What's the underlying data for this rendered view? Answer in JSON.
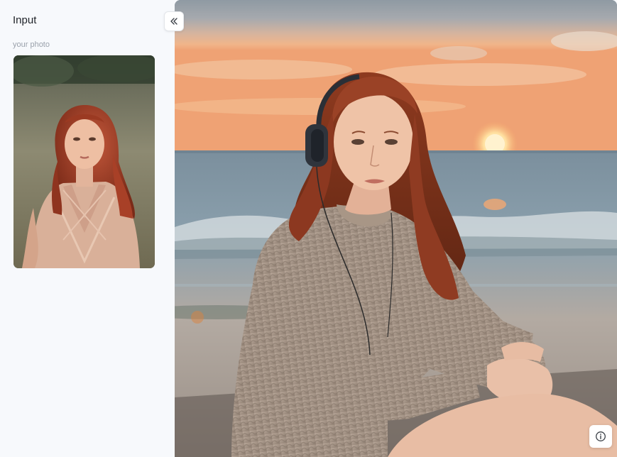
{
  "panel": {
    "title": "Input",
    "section_label": "your photo"
  },
  "icons": {
    "collapse": "double-chevron-left-icon",
    "info": "info-icon"
  },
  "colors": {
    "panel_bg": "#f7f9fc",
    "text_primary": "#1f2329",
    "text_muted": "#9aa1ab"
  }
}
